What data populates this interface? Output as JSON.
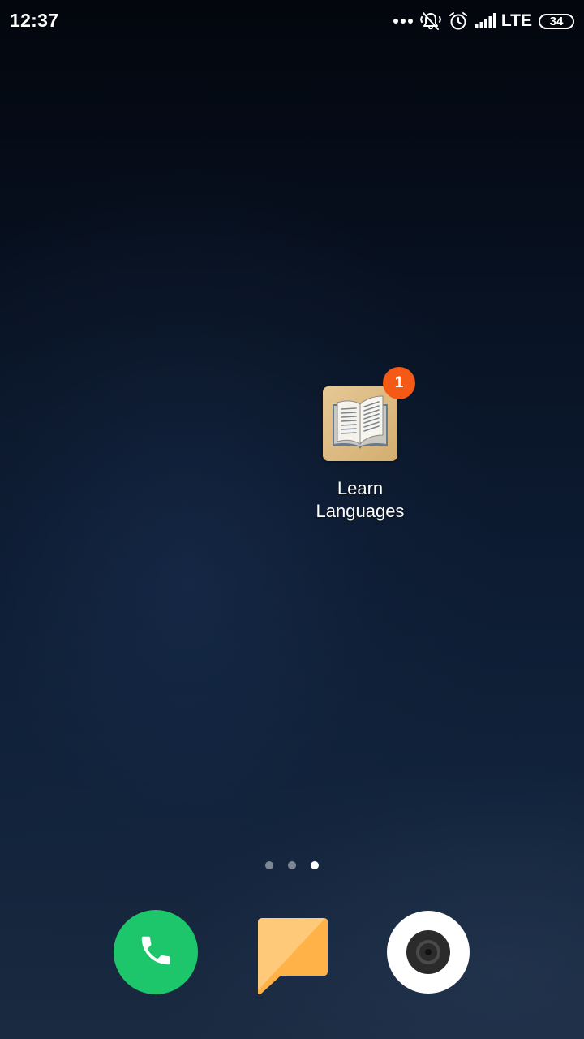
{
  "status_bar": {
    "time": "12:37",
    "network_type": "LTE",
    "battery_level": "34",
    "icons": [
      "more-dots-icon",
      "vibrate-icon",
      "alarm-clock-icon",
      "signal-strength-icon",
      "battery-icon"
    ]
  },
  "home_screen": {
    "apps": [
      {
        "label": "Learn Languages",
        "label_line1": "Learn",
        "label_line2": "Languages",
        "icon": "open-book-icon",
        "badge_count": "1"
      }
    ],
    "page_indicator": {
      "page_count": 3,
      "current_page": 3
    },
    "dock": [
      {
        "name": "phone",
        "icon": "phone-icon",
        "color": "#1ec66b"
      },
      {
        "name": "messages",
        "icon": "message-bubble-icon",
        "color": "#ffb955"
      },
      {
        "name": "camera",
        "icon": "camera-lens-icon",
        "color": "#ffffff"
      }
    ]
  },
  "colors": {
    "badge": "#f45a16",
    "wallpaper_top": "#03060d",
    "wallpaper_bottom": "#1a2a40"
  }
}
